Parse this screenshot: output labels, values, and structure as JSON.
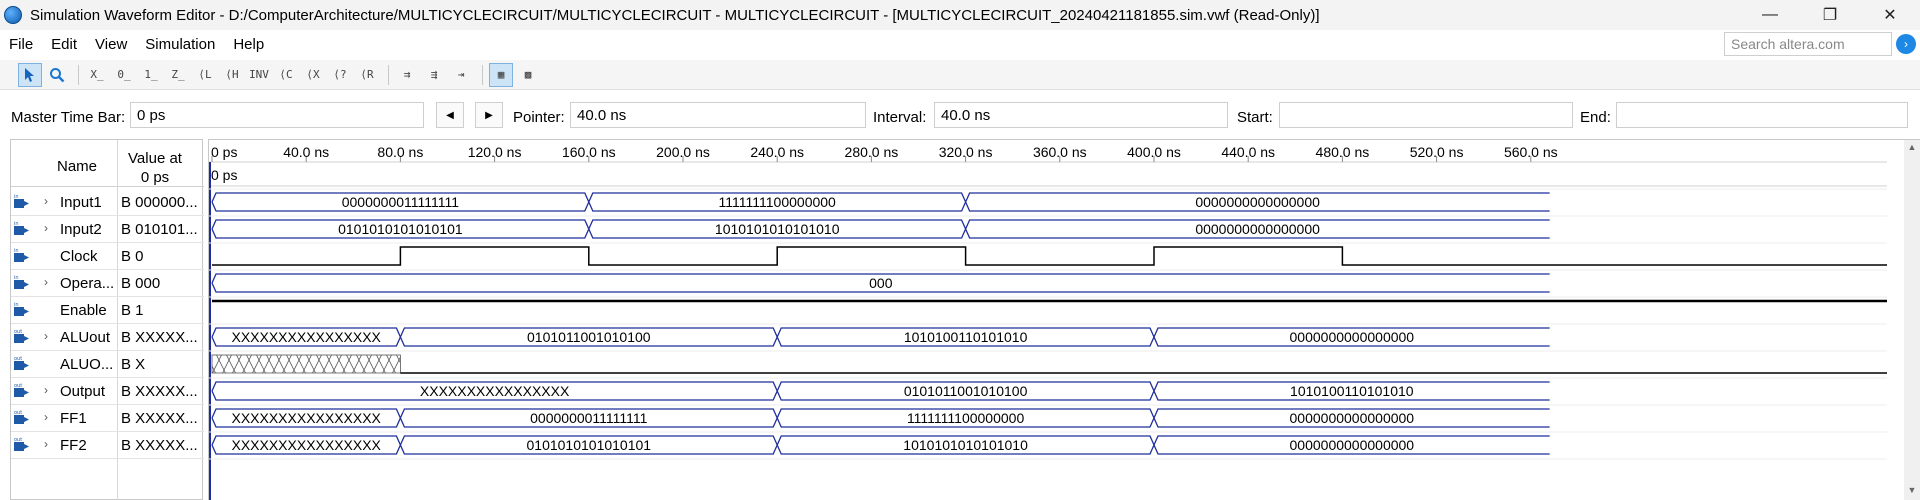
{
  "window": {
    "title": "Simulation Waveform Editor - D:/ComputerArchitecture/MULTICYCLECIRCUIT/MULTICYCLECIRCUIT - MULTICYCLECIRCUIT - [MULTICYCLECIRCUIT_20240421181855.sim.vwf (Read-Only)]",
    "minimize": "—",
    "restore": "❐",
    "close": "✕"
  },
  "menu": {
    "items": [
      "File",
      "Edit",
      "View",
      "Simulation",
      "Help"
    ],
    "search_placeholder": "Search altera.com"
  },
  "toolbar": {
    "buttons": [
      "select-tool",
      "zoom-tool",
      "forcing-unknown",
      "forcing-low",
      "forcing-high",
      "high-impedance",
      "weak-unknown",
      "weak-low",
      "weak-high",
      "invert",
      "count-value",
      "clock",
      "random-value",
      "arbitrary-value",
      "overwrite-clock",
      "group-sim-1",
      "group-sim-2",
      "snap-to-grid",
      "grid-settings"
    ]
  },
  "timebar": {
    "master_label": "Master Time Bar:",
    "master_value": "0 ps",
    "pointer_label": "Pointer:",
    "pointer_value": "40.0 ns",
    "interval_label": "Interval:",
    "interval_value": "40.0 ns",
    "start_label": "Start:",
    "start_value": "",
    "end_label": "End:",
    "end_value": ""
  },
  "signal_panel": {
    "header_name": "Name",
    "header_value_line1": "Value at",
    "header_value_line2": "0 ps",
    "signals": [
      {
        "name": "Input1",
        "value": "B 000000...",
        "dir": "in",
        "expandable": true
      },
      {
        "name": "Input2",
        "value": "B 010101...",
        "dir": "in",
        "expandable": true
      },
      {
        "name": "Clock",
        "value": "B 0",
        "dir": "in",
        "expandable": false
      },
      {
        "name": "Opera...",
        "value": "B 000",
        "dir": "in",
        "expandable": true
      },
      {
        "name": "Enable",
        "value": "B 1",
        "dir": "in",
        "expandable": false
      },
      {
        "name": "ALUout",
        "value": "B XXXXX...",
        "dir": "out",
        "expandable": true
      },
      {
        "name": "ALUO...",
        "value": "B X",
        "dir": "out",
        "expandable": false
      },
      {
        "name": "Output",
        "value": "B XXXXX...",
        "dir": "out",
        "expandable": true
      },
      {
        "name": "FF1",
        "value": "B XXXXX...",
        "dir": "out",
        "expandable": true
      },
      {
        "name": "FF2",
        "value": "B XXXXX...",
        "dir": "out",
        "expandable": true
      }
    ]
  },
  "waveform": {
    "time_labels": [
      "0 ps",
      "40.0 ns",
      "80.0 ns",
      "120.0 ns",
      "160.0 ns",
      "200.0 ns",
      "240.0 ns",
      "280.0 ns",
      "320.0 ns",
      "360.0 ns",
      "400.0 ns",
      "440.0 ns",
      "480.0 ns",
      "520.0 ns",
      "560.0 ns"
    ],
    "time_label_values_ns": [
      0,
      40,
      80,
      120,
      160,
      200,
      240,
      280,
      320,
      360,
      400,
      440,
      480,
      520,
      560
    ],
    "marker_label": "0 ps",
    "visible_end_ns": 568,
    "buses": [
      {
        "row": 0,
        "segments": [
          {
            "t0": 0,
            "t1": 160,
            "label": "0000000011111111"
          },
          {
            "t0": 160,
            "t1": 320,
            "label": "1111111100000000"
          },
          {
            "t0": 320,
            "t1": 568,
            "label": "0000000000000000"
          }
        ]
      },
      {
        "row": 1,
        "segments": [
          {
            "t0": 0,
            "t1": 160,
            "label": "0101010101010101"
          },
          {
            "t0": 160,
            "t1": 320,
            "label": "1010101010101010"
          },
          {
            "t0": 320,
            "t1": 568,
            "label": "0000000000000000"
          }
        ]
      },
      {
        "row": 3,
        "segments": [
          {
            "t0": 0,
            "t1": 568,
            "label": "000"
          }
        ]
      },
      {
        "row": 5,
        "segments": [
          {
            "t0": 0,
            "t1": 80,
            "label": "XXXXXXXXXXXXXXXX"
          },
          {
            "t0": 80,
            "t1": 240,
            "label": "0101011001010100"
          },
          {
            "t0": 240,
            "t1": 400,
            "label": "1010100110101010"
          },
          {
            "t0": 400,
            "t1": 568,
            "label": "0000000000000000"
          }
        ]
      },
      {
        "row": 7,
        "segments": [
          {
            "t0": 0,
            "t1": 240,
            "label": "XXXXXXXXXXXXXXXX"
          },
          {
            "t0": 240,
            "t1": 400,
            "label": "0101011001010100"
          },
          {
            "t0": 400,
            "t1": 568,
            "label": "1010100110101010"
          }
        ]
      },
      {
        "row": 8,
        "segments": [
          {
            "t0": 0,
            "t1": 80,
            "label": "XXXXXXXXXXXXXXXX"
          },
          {
            "t0": 80,
            "t1": 240,
            "label": "0000000011111111"
          },
          {
            "t0": 240,
            "t1": 400,
            "label": "1111111100000000"
          },
          {
            "t0": 400,
            "t1": 568,
            "label": "0000000000000000"
          }
        ]
      },
      {
        "row": 9,
        "segments": [
          {
            "t0": 0,
            "t1": 80,
            "label": "XXXXXXXXXXXXXXXX"
          },
          {
            "t0": 80,
            "t1": 240,
            "label": "0101010101010101"
          },
          {
            "t0": 240,
            "t1": 400,
            "label": "1010101010101010"
          },
          {
            "t0": 400,
            "t1": 568,
            "label": "0000000000000000"
          }
        ]
      }
    ],
    "clock": {
      "row": 2,
      "initial": 0,
      "edges_ns": [
        80,
        160,
        240,
        320,
        400,
        480
      ]
    },
    "enable": {
      "row": 4,
      "level": 1
    },
    "aluo_bit": {
      "row": 6,
      "unknown_until_ns": 80,
      "level_after": 0
    },
    "colors": {
      "bus_line": "#1f2d9c",
      "clock_line": "#000000",
      "grid_line": "#e6e6e6"
    }
  }
}
